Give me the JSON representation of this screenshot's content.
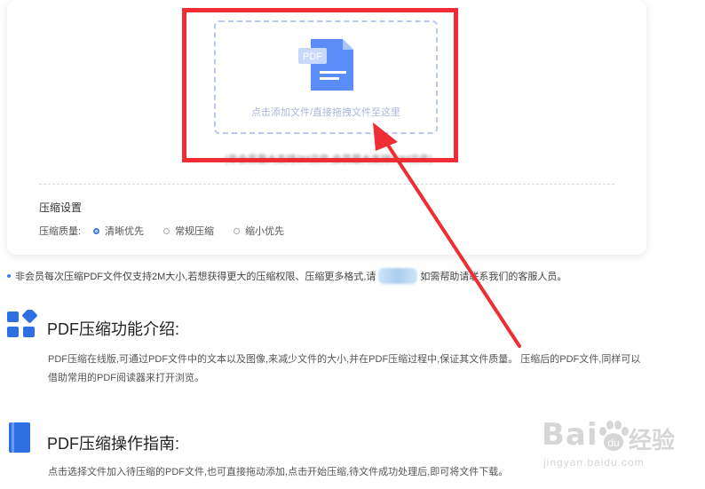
{
  "upload": {
    "drop_text": "点击添加文件/直接拖拽文件至这里",
    "limit_text": "(非会员最大支持2M文件,会员最大支持50M文件)",
    "icon": "pdf-file-icon",
    "icon_label": "PDF"
  },
  "settings": {
    "title": "压缩设置",
    "quality_label": "压缩质量:",
    "options": [
      "清晰优先",
      "常规压缩",
      "缩小优先"
    ],
    "selected": "清晰优先"
  },
  "notice": {
    "text_before": "非会员每次压缩PDF文件仅支持2M大小,若想获得更大的压缩权限、压缩更多格式,请",
    "text_after": "如需帮助请联系我们的客服人员。"
  },
  "intro": {
    "title": "PDF压缩功能介绍:",
    "line1": "PDF压缩在线版,可通过PDF文件中的文本以及图像,来减少文件的大小,并在PDF压缩过程中,保证其文件质量。 压缩后的PDF文件,同样可以",
    "line2": "借助常用的PDF阅读器来打开浏览。"
  },
  "guide": {
    "title": "PDF压缩操作指南:",
    "line1": "点击选择文件加入待压缩的PDF文件,也可直接拖动添加,点击开始压缩,待文件成功处理后,即可将文件下载。"
  },
  "watermark": {
    "brand": "Bai",
    "brand_suffix": "经验",
    "url": "jingyan.baidu.com"
  },
  "colors": {
    "accent": "#3d7cf4",
    "highlight": "#ef2d34"
  }
}
